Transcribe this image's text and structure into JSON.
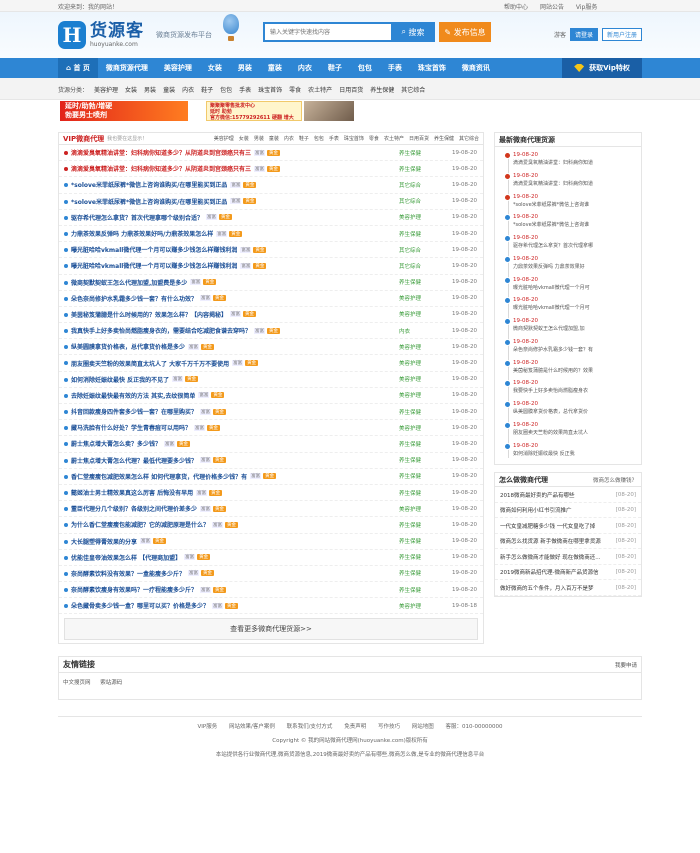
{
  "topbar": {
    "welcome": "欢迎来到：我的网站！",
    "links": [
      "帮助中心",
      "网站公告",
      "Vip服务"
    ]
  },
  "header": {
    "logo_cn": "货源客",
    "logo_en": "huoyuanke.com",
    "slogan": "微商货源发布平台",
    "search_placeholder": "输入关键字快速找内容",
    "search_label": "搜索",
    "publish_label": "发布信息",
    "visitor": "游客",
    "login_label": "请登录",
    "register_label": "新用户注册"
  },
  "nav": {
    "items": [
      "首 页",
      "微商货源代理",
      "美容护理",
      "女装",
      "男装",
      "童装",
      "内衣",
      "鞋子",
      "包包",
      "手表",
      "珠宝首饰",
      "微商资讯"
    ],
    "vip_label": "获取Vip特权"
  },
  "catbar": {
    "label": "货源分类：",
    "items": [
      "美容护理",
      "女装",
      "男装",
      "童装",
      "内衣",
      "鞋子",
      "包包",
      "手表",
      "珠宝首饰",
      "零食",
      "农土特产",
      "日用百货",
      "养生保健",
      "其它综合"
    ],
    "ad_left_line1": "延时/助勃/增硬",
    "ad_left_line2": "勃要男士喷剂",
    "ad_mid_line1": "聚聚聚零售批发中心",
    "ad_mid_line2": "延时 助勃",
    "ad_mid_line3": "官方微信:15779292611 硬翻 增大"
  },
  "left": {
    "title": "VIP微商代理",
    "subtitle": "我也要在这显示！",
    "tabs": [
      "美容护理",
      "女装",
      "男装",
      "童装",
      "内衣",
      "鞋子",
      "包包",
      "手表",
      "珠宝首饰",
      "零食",
      "农土特产",
      "日用百货",
      "养生保健",
      "其它综合"
    ],
    "tag_label": "富富",
    "badge_label": "黄金",
    "more_label": "查看更多微商代理货源>>",
    "rows": [
      {
        "title": "滴滴爱臭氧精油讲堂：妇科病你知道多少？从阴道炎到宫颈癌只有三",
        "cat": "养生保健",
        "date": "19-08-20",
        "hot": true
      },
      {
        "title": "滴滴爱臭氧精油讲堂：妇科病你知道多少？从阴道炎到宫颈癌只有三",
        "cat": "养生保健",
        "date": "19-08-20",
        "hot": true
      },
      {
        "title": "*solove米菲纸尿裤*微信上咨询谁购买/在哪里能买到正品",
        "cat": "其它综合",
        "date": "19-08-20",
        "hot": false
      },
      {
        "title": "*solove米菲纸尿裤*微信上咨询谁购买/在哪里能买到正品",
        "cat": "其它综合",
        "date": "19-08-20",
        "hot": false
      },
      {
        "title": "驱存希代理怎么拿货？首次代理拿哪个级别合适？",
        "cat": "美容护理",
        "date": "19-08-20",
        "hot": false
      },
      {
        "title": "力鼎茶效果反弹吗 力鼎茶效果好吗/力鼎茶效果怎么样",
        "cat": "养生保健",
        "date": "19-08-20",
        "hot": false
      },
      {
        "title": "曝光脏哈哈vkmall微代理一个月可以赚多少钱怎么样赚钱利润",
        "cat": "其它综合",
        "date": "19-08-20",
        "hot": false
      },
      {
        "title": "曝光脏哈哈vkmall微代理一个月可以赚多少钱怎么样赚钱利润",
        "cat": "其它综合",
        "date": "19-08-20",
        "hot": false
      },
      {
        "title": "微商契默契蚁王怎么代理加盟,加盟费是多少",
        "cat": "养生保健",
        "date": "19-08-20",
        "hot": false
      },
      {
        "title": "朵色奈尚修护水乳霜多少钱一套？有什么功效？",
        "cat": "美容护理",
        "date": "19-08-20",
        "hot": false
      },
      {
        "title": "美茵秘笈蒲臆是什么时候用的？效果怎么样？【内容揭秘】",
        "cat": "美容护理",
        "date": "19-08-20",
        "hot": false
      },
      {
        "title": "我真快手上好多卖怡尚燃脂瘦身衣的，需要结合吃减肥食谱去穿吗？",
        "cat": "内衣",
        "date": "19-08-20",
        "hot": false
      },
      {
        "title": "纵美圆膜拿货价格表，总代拿货价格是多少",
        "cat": "美容护理",
        "date": "19-08-20",
        "hot": false
      },
      {
        "title": "朋友圈卖天竺粉的效果简直太坑人了 大家千万千万不要使用",
        "cat": "美容护理",
        "date": "19-08-20",
        "hot": false
      },
      {
        "title": "如何消除妊娠纹最快 反正我的不见了",
        "cat": "美容护理",
        "date": "19-08-20",
        "hot": false
      },
      {
        "title": "去除妊娠纹最快最有效的方法 其实,去纹很简单",
        "cat": "美容护理",
        "date": "19-08-20",
        "hot": false
      },
      {
        "title": "抖音回款瘦身四件套多少钱一套？在哪里购买？",
        "cat": "养生保健",
        "date": "19-08-20",
        "hot": false
      },
      {
        "title": "藏马洗脸有什么好处？学生青春痘可以用吗？",
        "cat": "美容护理",
        "date": "19-08-20",
        "hot": false
      },
      {
        "title": "蔚士焦点增大膏怎么卖？多少钱？",
        "cat": "养生保健",
        "date": "19-08-20",
        "hot": false
      },
      {
        "title": "蔚士焦点增大膏怎么代理？最低代理要多少钱？",
        "cat": "养生保健",
        "date": "19-08-20",
        "hot": false
      },
      {
        "title": "香仁堂瘦瘦包减肥效果怎么样 如何代理拿货，代理价格多少钱？有",
        "cat": "养生保健",
        "date": "19-08-20",
        "hot": false
      },
      {
        "title": "懿姬油士男士精效果真这么厉害 后悔没有早用",
        "cat": "养生保健",
        "date": "19-08-20",
        "hot": false
      },
      {
        "title": "董臣代理分几个级别？各级别之间代理价差多少",
        "cat": "美容护理",
        "date": "19-08-20",
        "hot": false
      },
      {
        "title": "为什么香仁堂瘦瘦包能减肥？它的减肥原理是什么？",
        "cat": "养生保健",
        "date": "19-08-20",
        "hot": false
      },
      {
        "title": "大长腿塑得膏效果的分享",
        "cat": "养生保健",
        "date": "19-08-20",
        "hot": false
      },
      {
        "title": "优能佳皇帝油效果怎么样 【代理商加盟】",
        "cat": "养生保健",
        "date": "19-08-20",
        "hot": false
      },
      {
        "title": "奈尚酵素饮料没有效果？一盒能瘦多少斤？",
        "cat": "养生保健",
        "date": "19-08-20",
        "hot": false
      },
      {
        "title": "奈尚酵素饮瘦身有效果吗？一疗程能瘦多少斤？",
        "cat": "养生保健",
        "date": "19-08-20",
        "hot": false
      },
      {
        "title": "朵色藏骨卖多少钱一盒？哪里可以买？价格是多少？",
        "cat": "美容护理",
        "date": "19-08-18",
        "hot": false
      }
    ]
  },
  "right": {
    "title": "最新微商代理货源",
    "timeline": [
      {
        "date": "19-08-20",
        "text": "滴滴爱臭氧精油讲堂：妇科病你知道",
        "red": true
      },
      {
        "date": "19-08-20",
        "text": "滴滴爱臭氧精油讲堂：妇科病你知道",
        "red": true
      },
      {
        "date": "19-08-20",
        "text": "*solove米菲纸尿裤*微信上咨询谁",
        "red": true
      },
      {
        "date": "19-08-20",
        "text": "*solove米菲纸尿裤*微信上咨询谁",
        "red": false
      },
      {
        "date": "19-08-20",
        "text": "驱存希代理怎么拿货？首次代理拿哪",
        "red": false
      },
      {
        "date": "19-08-20",
        "text": "力鼎茶效果反弹吗 力鼎茶效果好",
        "red": false
      },
      {
        "date": "19-08-20",
        "text": "曝光脏哈哈vkmall微代理一个月可",
        "red": false
      },
      {
        "date": "19-08-20",
        "text": "曝光脏哈哈vkmall微代理一个月可",
        "red": false
      },
      {
        "date": "19-08-20",
        "text": "微商契默契蚁王怎么代理加盟,加",
        "red": false
      },
      {
        "date": "19-08-20",
        "text": "朵色奈尚修护水乳霜多少钱一套？有",
        "red": false
      },
      {
        "date": "19-08-20",
        "text": "美茵秘笈蒲臆是什么时候用的？效果",
        "red": false
      },
      {
        "date": "19-08-20",
        "text": "我要快手上好多卖怡尚燃脂瘦身衣",
        "red": false
      },
      {
        "date": "19-08-20",
        "text": "纵美圆膜拿货价格表，总代拿货价",
        "red": false
      },
      {
        "date": "19-08-20",
        "text": "朋友圈卖天竺粉的效果简直太坑人",
        "red": false
      },
      {
        "date": "19-08-20",
        "text": "如何消除妊娠纹最快 反正我",
        "red": false
      }
    ],
    "title2": "怎么做微商代理",
    "more2": "微商怎么做赚钱？",
    "list2": [
      {
        "text": "2018微商最好卖的产品有哪些",
        "date": "[08-20]"
      },
      {
        "text": "微商如何利用小红书引流推广",
        "date": "[08-20]"
      },
      {
        "text": "一代女皇减肥糖多少钱 一代女皇吃了掉",
        "date": "[08-20]"
      },
      {
        "text": "微商怎么找货源 新手做微商在哪里拿货源",
        "date": "[08-20]"
      },
      {
        "text": "新手怎么做微商才能做好 现在做微商还...",
        "date": "[08-20]"
      },
      {
        "text": "2019微商新品招代理-微商新产品货源信",
        "date": "[08-20]"
      },
      {
        "text": "做好微商的五个条件，月入百万不是梦",
        "date": "[08-20]"
      }
    ]
  },
  "friends": {
    "title": "友情链接",
    "apply": "我要申请",
    "links": [
      "中文搜页网",
      "索站源码"
    ]
  },
  "footer": {
    "links": [
      "VIP服务",
      "网站效果/客户案例",
      "联系我们/支付方式",
      "免责声明",
      "写作技巧",
      "网站地图",
      "客服：010-00000000"
    ],
    "copyright": "Copyright © 我的网站微商代理网(huoyuanke.com)版权所有",
    "desc": "本站提供各行业微商代理,微商货源信息,2019微商最好卖的产品有哪些,微商怎么做,是专业的微商代理信息平台"
  }
}
